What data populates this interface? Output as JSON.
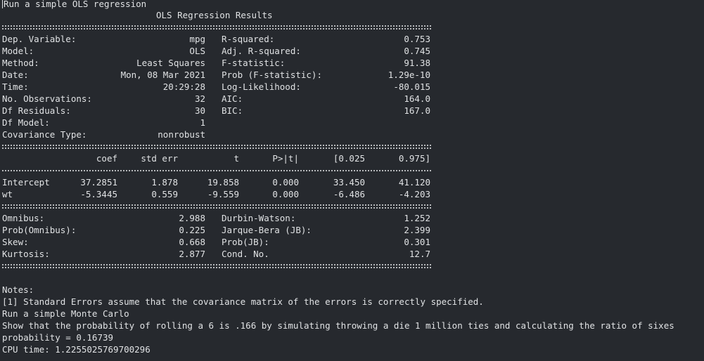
{
  "header": {
    "run_label": "Run a simple OLS regression",
    "title": "OLS Regression Results"
  },
  "summary_left": [
    {
      "label": "Dep. Variable:",
      "value": "mpg"
    },
    {
      "label": "Model:",
      "value": "OLS"
    },
    {
      "label": "Method:",
      "value": "Least Squares"
    },
    {
      "label": "Date:",
      "value": "Mon, 08 Mar 2021"
    },
    {
      "label": "Time:",
      "value": "20:29:28"
    },
    {
      "label": "No. Observations:",
      "value": "32"
    },
    {
      "label": "Df Residuals:",
      "value": "30"
    },
    {
      "label": "Df Model:",
      "value": "1"
    },
    {
      "label": "Covariance Type:",
      "value": "nonrobust"
    }
  ],
  "summary_right": [
    {
      "label": "R-squared:",
      "value": "0.753"
    },
    {
      "label": "Adj. R-squared:",
      "value": "0.745"
    },
    {
      "label": "F-statistic:",
      "value": "91.38"
    },
    {
      "label": "Prob (F-statistic):",
      "value": "1.29e-10"
    },
    {
      "label": "Log-Likelihood:",
      "value": "-80.015"
    },
    {
      "label": "AIC:",
      "value": "164.0"
    },
    {
      "label": "BIC:",
      "value": "167.0"
    }
  ],
  "coef_table": {
    "headers": [
      "coef",
      "std err",
      "t",
      "P>|t|",
      "[0.025",
      "0.975]"
    ],
    "rows": [
      {
        "name": "Intercept",
        "cells": [
          "37.2851",
          "1.878",
          "19.858",
          "0.000",
          "33.450",
          "41.120"
        ]
      },
      {
        "name": "wt",
        "cells": [
          "-5.3445",
          "0.559",
          "-9.559",
          "0.000",
          "-6.486",
          "-4.203"
        ]
      }
    ]
  },
  "diag_left": [
    {
      "label": "Omnibus:",
      "value": "2.988"
    },
    {
      "label": "Prob(Omnibus):",
      "value": "0.225"
    },
    {
      "label": "Skew:",
      "value": "0.668"
    },
    {
      "label": "Kurtosis:",
      "value": "2.877"
    }
  ],
  "diag_right": [
    {
      "label": "Durbin-Watson:",
      "value": "1.252"
    },
    {
      "label": "Jarque-Bera (JB):",
      "value": "2.399"
    },
    {
      "label": "Prob(JB):",
      "value": "0.301"
    },
    {
      "label": "Cond. No.",
      "value": "12.7"
    }
  ],
  "notes": {
    "heading": "Notes:",
    "note1": "[1] Standard Errors assume that the covariance matrix of the errors is correctly specified."
  },
  "monte_carlo": {
    "run_label": "Run a simple Monte Carlo",
    "description": "Show that the probability of rolling a 6 is .166 by simulating throwing a die 1 million ties and calculating the ratio of sixes",
    "probability": "probability = 0.16739",
    "cpu_time": "CPU time: 1.2255025769700296"
  },
  "colors": {
    "background": "#26292e",
    "text": "#e0e2e4",
    "separator": "#b8babd"
  }
}
